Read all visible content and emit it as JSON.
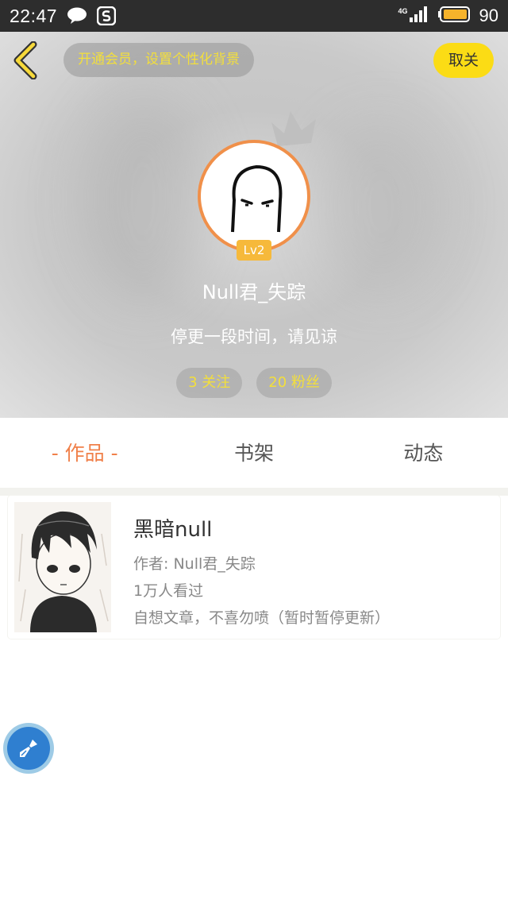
{
  "status_bar": {
    "time": "22:47",
    "network": "4G",
    "battery_percent": "90"
  },
  "header": {
    "vip_prompt": "开通会员，设置个性化背景",
    "unfollow_label": "取关",
    "level": "Lv2",
    "username": "Null君_失踪",
    "bio": "停更一段时间，请见谅",
    "following": "3 关注",
    "followers": "20 粉丝"
  },
  "tabs": [
    {
      "label": "- 作品 -",
      "active": true
    },
    {
      "label": "书架",
      "active": false
    },
    {
      "label": "动态",
      "active": false
    }
  ],
  "works": [
    {
      "title": "黑暗null",
      "author": "作者: Null君_失踪",
      "views": "1万人看过",
      "description": "自想文章，不喜勿喷（暂时暂停更新）"
    }
  ],
  "colors": {
    "accent_orange": "#f0804a",
    "accent_yellow": "#fbdc15",
    "status_bar_bg": "#2d2d2d"
  },
  "icons": {
    "back": "back-arrow-icon",
    "fab": "brush-icon"
  }
}
